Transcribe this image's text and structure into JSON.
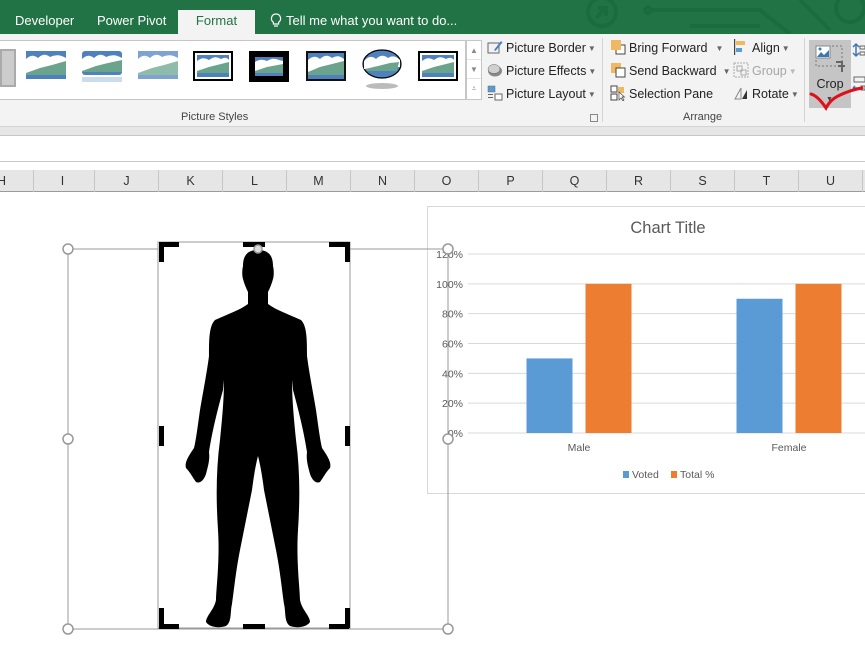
{
  "tabs": [
    {
      "label": "Developer",
      "active": false
    },
    {
      "label": "Power Pivot",
      "active": false
    },
    {
      "label": "Format",
      "active": true
    }
  ],
  "tell_me": {
    "placeholder": "Tell me what you want to do..."
  },
  "ribbon": {
    "picture_styles": {
      "label": "Picture Styles",
      "styles": [
        "Simple Frame (partial)",
        "Soft Edge Rectangle",
        "Reflected Rounded Rectangle",
        "Soft Edge Rectangle Blur",
        "Double Frame, Black",
        "Thick Matte, Black",
        "Simple Frame, Black",
        "Reflected Oval",
        "Double Frame Black 2"
      ]
    },
    "picture_buttons": {
      "border": "Picture Border",
      "effects": "Picture Effects",
      "layout": "Picture Layout"
    },
    "arrange": {
      "label": "Arrange",
      "bring_forward": "Bring Forward",
      "send_backward": "Send Backward",
      "selection_pane": "Selection Pane",
      "align": "Align",
      "group": "Group",
      "rotate": "Rotate"
    },
    "size": {
      "crop": "Crop"
    }
  },
  "columns": [
    "H",
    "I",
    "J",
    "K",
    "L",
    "M",
    "N",
    "O",
    "P",
    "Q",
    "R",
    "S",
    "T",
    "U"
  ],
  "colors": {
    "excel_green": "#217346",
    "voted": "#5b9bd5",
    "total": "#ed7d31",
    "annotation_red": "#e0101a"
  },
  "chart_data": {
    "type": "bar",
    "title": "Chart Title",
    "categories": [
      "Male",
      "Female"
    ],
    "series": [
      {
        "name": "Voted",
        "values": [
          0.5,
          0.9
        ]
      },
      {
        "name": "Total %",
        "values": [
          1.0,
          1.0
        ]
      }
    ],
    "ylim": [
      0,
      1.2
    ],
    "yticks": [
      "0%",
      "20%",
      "40%",
      "60%",
      "80%",
      "100%",
      "120%"
    ],
    "ytick_values": [
      0,
      0.2,
      0.4,
      0.6,
      0.8,
      1.0,
      1.2
    ],
    "xlabel": "",
    "ylabel": "",
    "grid": true,
    "legend": "bottom"
  }
}
